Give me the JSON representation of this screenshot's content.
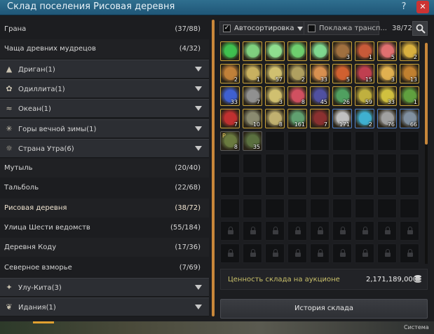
{
  "window": {
    "title": "Склад поселения Рисовая деревня"
  },
  "left_list": [
    {
      "kind": "village",
      "label": "Грана",
      "count": "(37/88)"
    },
    {
      "kind": "village",
      "label": "Чаща древних мудрецов",
      "count": "(4/32)"
    },
    {
      "kind": "region",
      "label": "Дриган(1)",
      "icon": "mountain-icon"
    },
    {
      "kind": "region",
      "label": "Одиллита(1)",
      "icon": "flower-icon"
    },
    {
      "kind": "region",
      "label": "Океан(1)",
      "icon": "wave-icon"
    },
    {
      "kind": "region",
      "label": "Горы вечной зимы(1)",
      "icon": "snowflake-icon"
    },
    {
      "kind": "region",
      "label": "Страна Утра(6)",
      "icon": "sun-icon"
    },
    {
      "kind": "village",
      "label": "Мутыль",
      "count": "(20/40)"
    },
    {
      "kind": "village",
      "label": "Тальболь",
      "count": "(22/68)"
    },
    {
      "kind": "village",
      "label": "Рисовая деревня",
      "count": "(38/72)",
      "selected": true
    },
    {
      "kind": "village",
      "label": "Улица Шести ведомств",
      "count": "(55/184)"
    },
    {
      "kind": "village",
      "label": "Деревня Коду",
      "count": "(17/36)"
    },
    {
      "kind": "village",
      "label": "Северное взморье",
      "count": "(7/69)"
    },
    {
      "kind": "region",
      "label": "Улу-Кита(3)",
      "icon": "star-icon"
    },
    {
      "kind": "region",
      "label": "Идания(1)",
      "icon": "leaf-icon"
    }
  ],
  "toolbar": {
    "autosort_label": "Автосортировка",
    "autosort_checked": "✓",
    "transp_label": "Поклажа трансп...",
    "slots": "38/72"
  },
  "items": [
    {
      "c": "#3fbf4f",
      "q": ""
    },
    {
      "c": "#7fd07f",
      "q": ""
    },
    {
      "c": "#8fdf8f",
      "q": ""
    },
    {
      "c": "#6fcf6f",
      "q": ""
    },
    {
      "c": "#7fd78f",
      "q": ""
    },
    {
      "c": "#a07040",
      "q": "3"
    },
    {
      "c": "#c85a3a",
      "q": "1"
    },
    {
      "c": "#e07070",
      "q": "5"
    },
    {
      "c": "#d8b040",
      "q": "2"
    },
    {
      "c": "#c0803a",
      "q": "2"
    },
    {
      "c": "#c8b060",
      "q": "1"
    },
    {
      "c": "#d0c070",
      "q": "57"
    },
    {
      "c": "#b0a060",
      "q": "2"
    },
    {
      "c": "#d89050",
      "q": "33"
    },
    {
      "c": "#d06030",
      "q": "5"
    },
    {
      "c": "#c04050",
      "q": "15"
    },
    {
      "c": "#e0b050",
      "q": "3"
    },
    {
      "c": "#c08030",
      "q": "13"
    },
    {
      "c": "#4060d0",
      "q": "33"
    },
    {
      "c": "#909090",
      "q": "7"
    },
    {
      "c": "#d0c070",
      "q": "3"
    },
    {
      "c": "#d05060",
      "q": "8"
    },
    {
      "c": "#5050a0",
      "q": "45"
    },
    {
      "c": "#50a060",
      "q": "26"
    },
    {
      "c": "#c0b040",
      "q": "59"
    },
    {
      "c": "#d0c040",
      "q": "33"
    },
    {
      "c": "#60a040",
      "q": "1"
    },
    {
      "c": "#c03030",
      "q": "7"
    },
    {
      "c": "#8a8a70",
      "q": "10"
    },
    {
      "c": "#c0b070",
      "q": "8"
    },
    {
      "c": "#60a070",
      "q": "161"
    },
    {
      "c": "#8a3030",
      "q": "7"
    },
    {
      "c": "#c0c0c0",
      "q": "171"
    },
    {
      "c": "#40b0d0",
      "q": "2"
    },
    {
      "c": "#a0a0a0",
      "q": "76"
    },
    {
      "c": "#8090a0",
      "q": "66"
    },
    {
      "c": "#6a7a40",
      "q": "8",
      "badge": "P"
    },
    {
      "c": "#5a7040",
      "q": "35"
    }
  ],
  "value_bar": {
    "label": "Ценность склада на аукционе",
    "value": "2,171,189,000"
  },
  "history_button": "История склада",
  "taskbar": {
    "system": "Система"
  }
}
